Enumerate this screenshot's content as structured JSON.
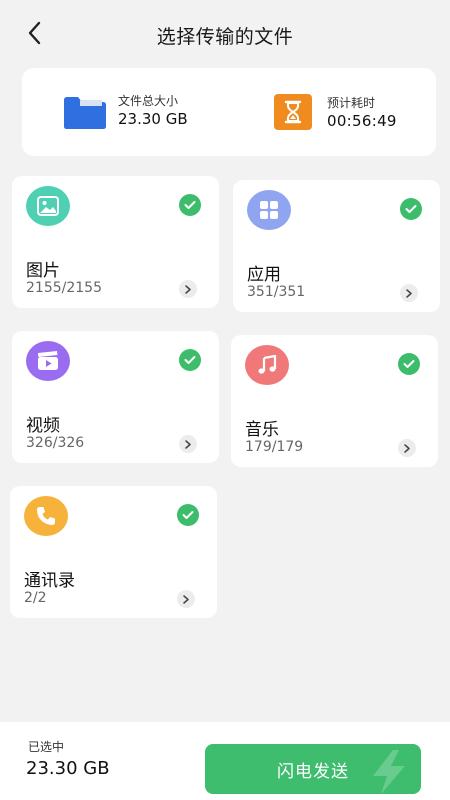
{
  "header": {
    "title": "选择传输的文件",
    "back_icon": "chevron-left-icon"
  },
  "summary": {
    "size_label": "文件总大小",
    "size_value": "23.30 GB",
    "time_label": "预计耗时",
    "time_value": "00:56:49",
    "folder_color": "#2f6fe0",
    "timer_color": "#f08c1f"
  },
  "categories": [
    {
      "name": "图片",
      "count": "2155/2155",
      "icon": "image-icon",
      "color": "#4fd0b3",
      "selected": true
    },
    {
      "name": "应用",
      "count": "351/351",
      "icon": "apps-grid-icon",
      "color": "#8fa5ef",
      "selected": true
    },
    {
      "name": "视频",
      "count": "326/326",
      "icon": "video-clapper-icon",
      "color": "#9a6cf0",
      "selected": true
    },
    {
      "name": "音乐",
      "count": "179/179",
      "icon": "music-note-icon",
      "color": "#f07878",
      "selected": true
    },
    {
      "name": "通讯录",
      "count": "2/2",
      "icon": "phone-icon",
      "color": "#f7b23b",
      "selected": true
    }
  ],
  "footer": {
    "selected_label": "已选中",
    "selected_value": "23.30 GB",
    "send_label": "闪电发送",
    "accent": "#3fbd6e"
  }
}
